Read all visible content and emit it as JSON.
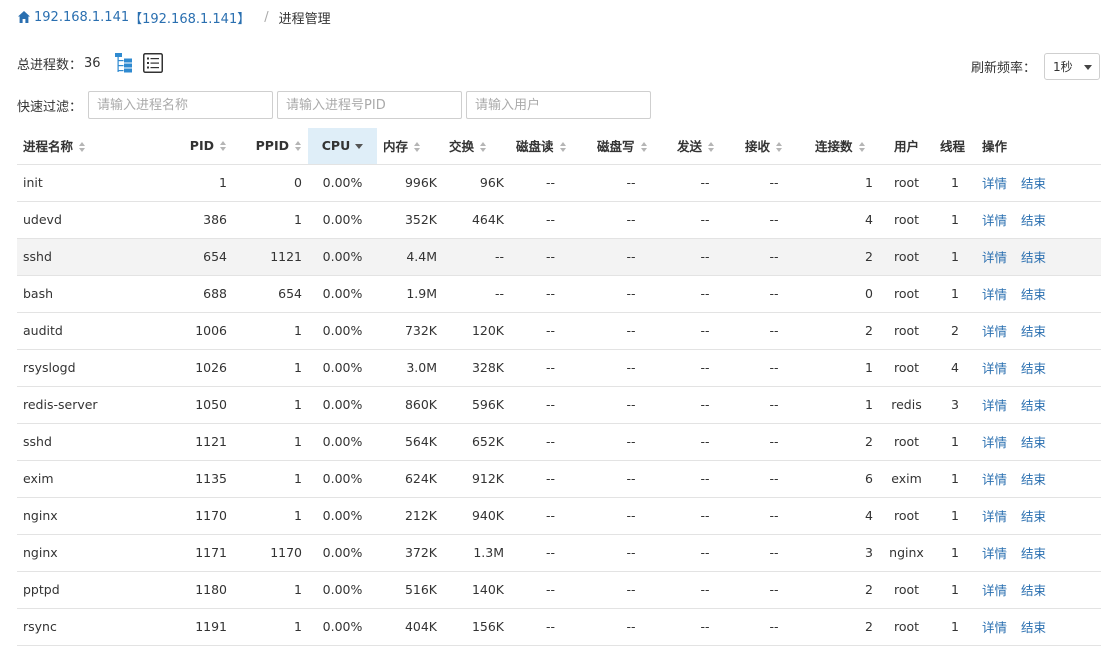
{
  "breadcrumb": {
    "host_ip": "192.168.1.141",
    "host_bracket": "【192.168.1.141】",
    "separator": "/",
    "current": "进程管理"
  },
  "summary": {
    "label": "总进程数：",
    "count": "36",
    "icons": [
      "tree-view-icon",
      "list-view-icon"
    ]
  },
  "refresh": {
    "label": "刷新频率：",
    "selected": "1秒"
  },
  "filter": {
    "label": "快速过滤：",
    "name_placeholder": "请输入进程名称",
    "pid_placeholder": "请输入进程号PID",
    "user_placeholder": "请输入用户"
  },
  "table": {
    "columns": {
      "name": "进程名称",
      "pid": "PID",
      "ppid": "PPID",
      "cpu": "CPU",
      "mem": "内存",
      "swap": "交换",
      "disk_read": "磁盘读",
      "disk_write": "磁盘写",
      "send": "发送",
      "recv": "接收",
      "conns": "连接数",
      "user": "用户",
      "threads": "线程",
      "ops": "操作"
    },
    "sorted_column": "cpu",
    "detail_label": "详情",
    "kill_label": "结束",
    "highlighted_row": 2,
    "rows": [
      {
        "name": "init",
        "pid": "1",
        "ppid": "0",
        "cpu": "0.00%",
        "mem": "996K",
        "swap": "96K",
        "disk_read": "--",
        "disk_write": "--",
        "send": "--",
        "recv": "--",
        "conns": "1",
        "user": "root",
        "threads": "1"
      },
      {
        "name": "udevd",
        "pid": "386",
        "ppid": "1",
        "cpu": "0.00%",
        "mem": "352K",
        "swap": "464K",
        "disk_read": "--",
        "disk_write": "--",
        "send": "--",
        "recv": "--",
        "conns": "4",
        "user": "root",
        "threads": "1"
      },
      {
        "name": "sshd",
        "pid": "654",
        "ppid": "1121",
        "cpu": "0.00%",
        "mem": "4.4M",
        "swap": "--",
        "disk_read": "--",
        "disk_write": "--",
        "send": "--",
        "recv": "--",
        "conns": "2",
        "user": "root",
        "threads": "1"
      },
      {
        "name": "bash",
        "pid": "688",
        "ppid": "654",
        "cpu": "0.00%",
        "mem": "1.9M",
        "swap": "--",
        "disk_read": "--",
        "disk_write": "--",
        "send": "--",
        "recv": "--",
        "conns": "0",
        "user": "root",
        "threads": "1"
      },
      {
        "name": "auditd",
        "pid": "1006",
        "ppid": "1",
        "cpu": "0.00%",
        "mem": "732K",
        "swap": "120K",
        "disk_read": "--",
        "disk_write": "--",
        "send": "--",
        "recv": "--",
        "conns": "2",
        "user": "root",
        "threads": "2"
      },
      {
        "name": "rsyslogd",
        "pid": "1026",
        "ppid": "1",
        "cpu": "0.00%",
        "mem": "3.0M",
        "swap": "328K",
        "disk_read": "--",
        "disk_write": "--",
        "send": "--",
        "recv": "--",
        "conns": "1",
        "user": "root",
        "threads": "4"
      },
      {
        "name": "redis-server",
        "pid": "1050",
        "ppid": "1",
        "cpu": "0.00%",
        "mem": "860K",
        "swap": "596K",
        "disk_read": "--",
        "disk_write": "--",
        "send": "--",
        "recv": "--",
        "conns": "1",
        "user": "redis",
        "threads": "3"
      },
      {
        "name": "sshd",
        "pid": "1121",
        "ppid": "1",
        "cpu": "0.00%",
        "mem": "564K",
        "swap": "652K",
        "disk_read": "--",
        "disk_write": "--",
        "send": "--",
        "recv": "--",
        "conns": "2",
        "user": "root",
        "threads": "1"
      },
      {
        "name": "exim",
        "pid": "1135",
        "ppid": "1",
        "cpu": "0.00%",
        "mem": "624K",
        "swap": "912K",
        "disk_read": "--",
        "disk_write": "--",
        "send": "--",
        "recv": "--",
        "conns": "6",
        "user": "exim",
        "threads": "1"
      },
      {
        "name": "nginx",
        "pid": "1170",
        "ppid": "1",
        "cpu": "0.00%",
        "mem": "212K",
        "swap": "940K",
        "disk_read": "--",
        "disk_write": "--",
        "send": "--",
        "recv": "--",
        "conns": "4",
        "user": "root",
        "threads": "1"
      },
      {
        "name": "nginx",
        "pid": "1171",
        "ppid": "1170",
        "cpu": "0.00%",
        "mem": "372K",
        "swap": "1.3M",
        "disk_read": "--",
        "disk_write": "--",
        "send": "--",
        "recv": "--",
        "conns": "3",
        "user": "nginx",
        "threads": "1"
      },
      {
        "name": "pptpd",
        "pid": "1180",
        "ppid": "1",
        "cpu": "0.00%",
        "mem": "516K",
        "swap": "140K",
        "disk_read": "--",
        "disk_write": "--",
        "send": "--",
        "recv": "--",
        "conns": "2",
        "user": "root",
        "threads": "1"
      },
      {
        "name": "rsync",
        "pid": "1191",
        "ppid": "1",
        "cpu": "0.00%",
        "mem": "404K",
        "swap": "156K",
        "disk_read": "--",
        "disk_write": "--",
        "send": "--",
        "recv": "--",
        "conns": "2",
        "user": "root",
        "threads": "1"
      }
    ]
  },
  "colors": {
    "link": "#2a6fb0",
    "sorted_header_bg": "#dfeef8",
    "highlight_row_bg": "#f3f3f3",
    "icon_blue": "#2f8ad0"
  }
}
